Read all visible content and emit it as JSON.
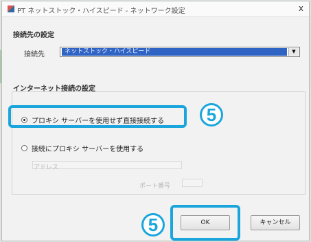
{
  "window": {
    "title": "PT ネットストック・ハイスピード - ネットワーク設定",
    "close_glyph": "x"
  },
  "connection": {
    "section_title": "接続先の設定",
    "field_label": "接続先",
    "selected_value": "ネットストック・ハイスピード"
  },
  "internet": {
    "section_title": "インターネット接続の設定",
    "option_direct": "プロキシ サーバーを使用せず直接接続する",
    "option_proxy": "接続にプロキシ サーバーを使用する",
    "proxy_address_label": "アドレス",
    "proxy_port_label": "ポート番号"
  },
  "buttons": {
    "ok": "OK",
    "cancel": "キャンセル"
  },
  "annotations": {
    "step_badge_1": "5",
    "step_badge_2": "5"
  },
  "colors": {
    "highlight": "#1aa6dc",
    "selection": "#2f63c4"
  }
}
